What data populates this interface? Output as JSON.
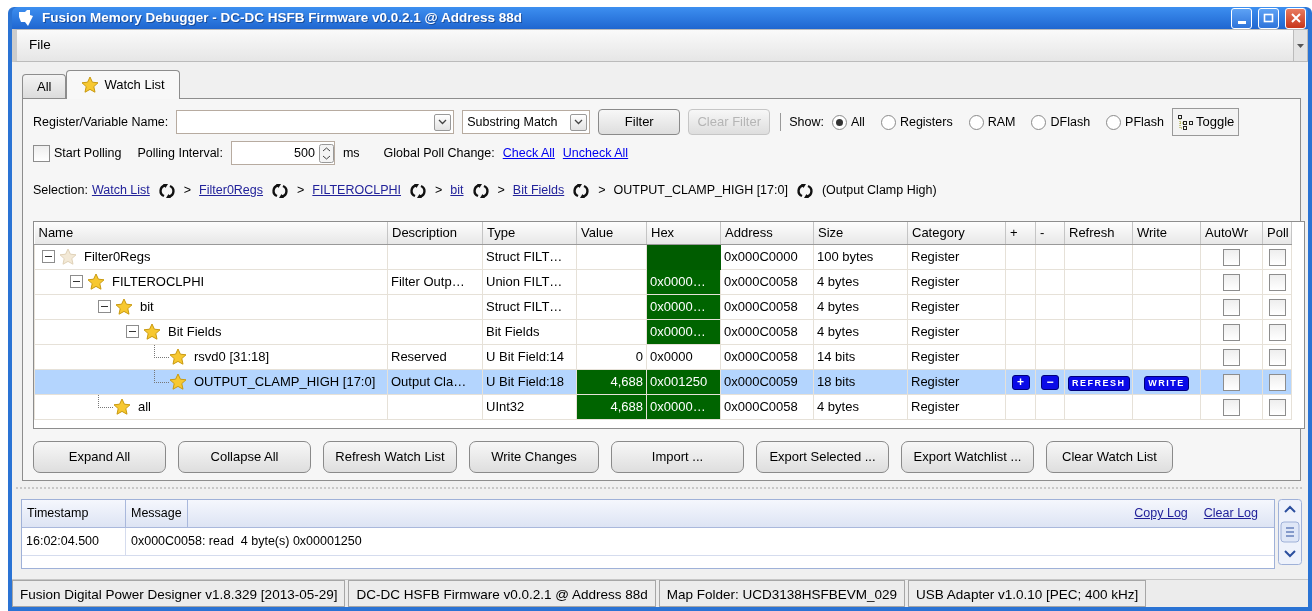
{
  "window": {
    "title": "Fusion Memory Debugger - DC-DC HSFB Firmware v0.0.2.1 @ Address 88d"
  },
  "menu": [
    "File"
  ],
  "tabs": [
    {
      "label": "All",
      "selected": false,
      "kind": "plain"
    },
    {
      "label": "Watch List",
      "selected": true,
      "kind": "starred"
    }
  ],
  "filter": {
    "label": "Register/Variable Name:",
    "match": "Substring Match",
    "filter_button": "Filter",
    "clear_button": {
      "label": "Clear Filter",
      "disabled": true
    },
    "show_label": "Show:",
    "options": [
      {
        "label": "All",
        "selected": true
      },
      {
        "label": "Registers",
        "selected": false
      },
      {
        "label": "RAM",
        "selected": false
      },
      {
        "label": "DFlash",
        "selected": false
      },
      {
        "label": "PFlash",
        "selected": false
      }
    ],
    "toggle": "Toggle"
  },
  "polling": {
    "checkbox": {
      "label": "Start Polling",
      "checked": false
    },
    "interval_label": "Polling Interval:",
    "interval": "500",
    "unit": "ms",
    "global_label": "Global Poll Change:",
    "links": [
      "Check All",
      "Uncheck All"
    ]
  },
  "selection": {
    "label": "Selection:",
    "crumbs": [
      {
        "label": "Watch List",
        "kind": "link"
      },
      {
        "label": "Filter0Regs",
        "kind": "link",
        "sep": ">"
      },
      {
        "label": "FILTEROCLPHI",
        "kind": "link",
        "sep": ">"
      },
      {
        "label": "bit",
        "kind": "link",
        "sep": ">"
      },
      {
        "label": "Bit Fields",
        "kind": "link",
        "sep": ">"
      },
      {
        "label": "OUTPUT_CLAMP_HIGH [17:0]",
        "kind": "current",
        "sep": ">"
      }
    ],
    "note": "(Output Clamp High)"
  },
  "table": {
    "columns": [
      "Name",
      "Description",
      "Type",
      "Value",
      "Hex",
      "Address",
      "Size",
      "Category",
      "+",
      "-",
      "Refresh",
      "Write",
      "AutoWr",
      "Poll"
    ],
    "rows": [
      {
        "name": "Filter0Regs",
        "starred": false,
        "expanded": true,
        "type": "Struct FILT…",
        "value_changed": false,
        "hex_changed": true,
        "address": "0x000C0000",
        "size": "100 bytes",
        "category": "Register",
        "selected": false,
        "autowrite": false,
        "poll": false,
        "children": [
          {
            "name": "FILTEROCLPHI",
            "starred": true,
            "expanded": true,
            "description": "Filter Outp…",
            "type": "Union FILT…",
            "value_changed": false,
            "hex": "0x0000…",
            "hex_changed": true,
            "address": "0x000C0058",
            "size": "4 bytes",
            "category": "Register",
            "selected": false,
            "autowrite": false,
            "poll": false,
            "children": [
              {
                "name": "bit",
                "starred": true,
                "expanded": true,
                "type": "Struct FILT…",
                "value_changed": false,
                "hex": "0x0000…",
                "hex_changed": true,
                "address": "0x000C0058",
                "size": "4 bytes",
                "category": "Register",
                "selected": false,
                "autowrite": false,
                "poll": false,
                "children": [
                  {
                    "name": "Bit Fields",
                    "starred": true,
                    "expanded": true,
                    "type": "Bit Fields",
                    "value_changed": false,
                    "hex": "0x0000…",
                    "hex_changed": true,
                    "address": "0x000C0058",
                    "size": "4 bytes",
                    "category": "Register",
                    "selected": false,
                    "autowrite": false,
                    "poll": false,
                    "children": [
                      {
                        "name": "rsvd0 [31:18]",
                        "starred": true,
                        "description": "Reserved",
                        "type": "U Bit Field:14",
                        "value": "0",
                        "value_changed": false,
                        "hex": "0x0000",
                        "hex_changed": false,
                        "address": "0x000C0058",
                        "size": "14 bits",
                        "category": "Register",
                        "selected": false,
                        "autowrite": false,
                        "poll": false
                      },
                      {
                        "name": "OUTPUT_CLAMP_HIGH [17:0]",
                        "starred": true,
                        "description": "Output Cla…",
                        "type": "U Bit Field:18",
                        "value": "4,688",
                        "value_changed": true,
                        "hex": "0x001250",
                        "hex_changed": true,
                        "address": "0x000C0059",
                        "size": "18 bits",
                        "category": "Register",
                        "selected": true,
                        "autowrite": false,
                        "poll": false,
                        "actions": {
                          "plus": "+",
                          "minus": "−",
                          "refresh": "REFRESH",
                          "write": "WRITE"
                        }
                      }
                    ]
                  }
                ]
              },
              {
                "name": "all",
                "starred": true,
                "type": "UInt32",
                "value": "4,688",
                "value_changed": true,
                "hex": "0x0000…",
                "hex_changed": true,
                "address": "0x000C0058",
                "size": "4 bytes",
                "category": "Register",
                "selected": false,
                "autowrite": false,
                "poll": false
              }
            ]
          }
        ]
      }
    ]
  },
  "buttons": [
    "Expand All",
    "Collapse All",
    "Refresh Watch List",
    "Write Changes",
    "Import ...",
    "Export Selected ...",
    "Export Watchlist ...",
    "Clear Watch List"
  ],
  "log": {
    "columns": [
      "Timestamp",
      "Message"
    ],
    "links": [
      "Copy Log",
      "Clear Log"
    ],
    "rows": [
      {
        "timestamp": "16:02:04.500",
        "message": "0x000C0058: read  4 byte(s) 0x00001250"
      }
    ]
  },
  "status_bar": [
    "Fusion Digital Power Designer v1.8.329 [2013-05-29]",
    "DC-DC HSFB Firmware v0.0.2.1 @ Address 88d",
    "Map Folder: UCD3138HSFBEVM_029",
    "USB Adapter v1.0.10 [PEC; 400 kHz]"
  ]
}
